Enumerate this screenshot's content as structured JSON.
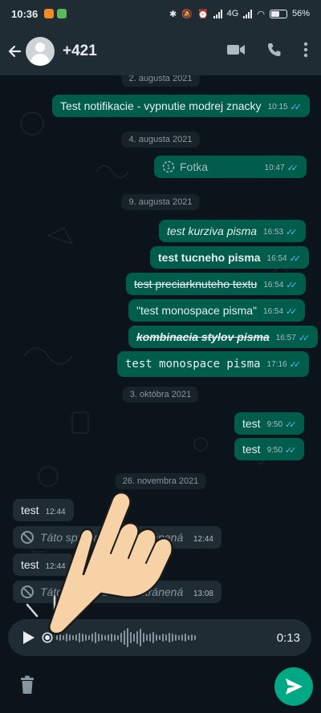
{
  "statusbar": {
    "time": "10:36",
    "battery": "56%",
    "network": "4G"
  },
  "header": {
    "contact": "+421"
  },
  "chat": {
    "dates": [
      "2. augusta 2021",
      "4. augusta 2021",
      "9. augusta 2021",
      "3. októbra 2021",
      "26. novembra 2021"
    ],
    "messages": [
      {
        "text": "Test notifikacie - vypnutie modrej znacky",
        "time": "10:15"
      },
      {
        "text": "Fotka",
        "time": "10:47"
      },
      {
        "text": "test kurziva pisma",
        "time": "16:53"
      },
      {
        "text": "test tucneho pisma",
        "time": "16:54"
      },
      {
        "text": "test preciarknuteho textu",
        "time": "16:54"
      },
      {
        "text": "\"test monospace pisma\"",
        "time": "16:54"
      },
      {
        "text": "kombinacia stylov pisma",
        "time": "16:57"
      },
      {
        "text": "test monospace pisma",
        "time": "17:16"
      },
      {
        "text": "test",
        "time": "9:50"
      },
      {
        "text": "test",
        "time": "9:50"
      },
      {
        "text": "test",
        "time": "12:44"
      },
      {
        "text": "Táto správa bola odstránená",
        "time": "12:44"
      },
      {
        "text": "test",
        "time": "12:44"
      },
      {
        "text": "Táto správa bola odstránená",
        "time": "13:08"
      }
    ]
  },
  "voice": {
    "duration": "0:13"
  },
  "colors": {
    "bg": "#0b141a",
    "header": "#1f2c34",
    "outgoing": "#005c4b",
    "incoming": "#202c33",
    "accent": "#00a884",
    "ticks": "#53bdeb"
  }
}
